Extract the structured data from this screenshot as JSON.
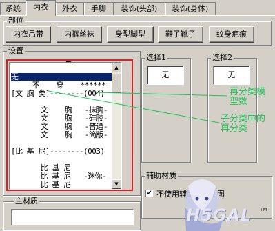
{
  "tabs": [
    {
      "label": "系统",
      "active": false
    },
    {
      "label": "内衣",
      "active": true
    },
    {
      "label": "外衣",
      "active": false
    },
    {
      "label": "手脚",
      "active": false
    },
    {
      "label": "装饰(头部)",
      "active": false
    },
    {
      "label": "装饰(身体)",
      "active": false
    }
  ],
  "parts": {
    "title": "部位",
    "buttons": [
      "内衣吊带",
      "内裤丝袜",
      "身型脚型",
      "鞋子靴子",
      "纹身疤痕"
    ]
  },
  "settings": {
    "title": "设置"
  },
  "list": {
    "header": "型",
    "rows": [
      "无",
      "     不    穿    ******",
      "[文 胸 类]--------(004)",
      "",
      "       文    胸   -抹胸-",
      "       文    胸   -硅胶-",
      "       文    胸   -普通-",
      "       文    胸   -简版-",
      "",
      "[比 基 尼]--------(003)",
      "",
      "       比 基 尼",
      "       比 基 尼   -迷你-",
      "       比 基 尼"
    ]
  },
  "select1": {
    "title": "选择1",
    "value": "无"
  },
  "select2": {
    "title": "选择2",
    "value": "无"
  },
  "annotations": {
    "a1": "再分类模\n型数",
    "a2": "子分类中的\n再分类"
  },
  "aux": {
    "title": "辅助材质",
    "checkbox_label": "不使用辅助材质贴图",
    "checked": true
  },
  "main_material": {
    "title": "主材质"
  },
  "watermark": "H5GAL",
  "colors": {
    "selection": "#0a246a",
    "frame": "#e21d2a",
    "annotation": "#21c45a"
  }
}
